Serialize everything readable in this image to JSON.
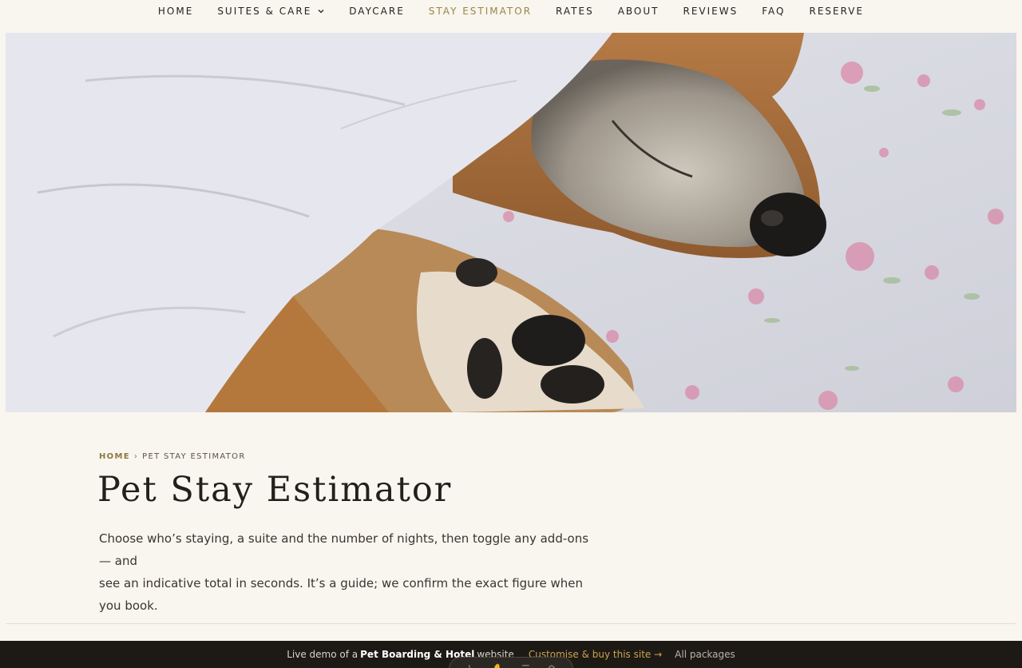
{
  "nav": {
    "items": [
      {
        "label": "HOME"
      },
      {
        "label": "SUITES & CARE",
        "has_dropdown": true
      },
      {
        "label": "DAYCARE"
      },
      {
        "label": "STAY ESTIMATOR",
        "active": true
      },
      {
        "label": "RATES"
      },
      {
        "label": "ABOUT"
      },
      {
        "label": "REVIEWS"
      },
      {
        "label": "FAQ"
      },
      {
        "label": "RESERVE"
      }
    ],
    "active_color": "#9a8548"
  },
  "hero": {
    "image": "sleeping-dog-under-blanket"
  },
  "breadcrumb": {
    "home": "HOME",
    "separator": "›",
    "current": "PET STAY ESTIMATOR"
  },
  "page": {
    "title": "Pet Stay Estimator",
    "intro_line1": "Choose who’s staying, a suite and the number of nights, then toggle any add-ons — and",
    "intro_line2": "see an indicative total in seconds. It’s a guide; we confirm the exact figure when you book."
  },
  "demo_bar": {
    "prefix": "Live demo of a",
    "bold": "Pet Boarding & Hotel",
    "suffix": "website",
    "cta": "Customise & buy this site →",
    "packages": "All packages",
    "accent": "#c9a24e",
    "background": "#1d1a16"
  }
}
